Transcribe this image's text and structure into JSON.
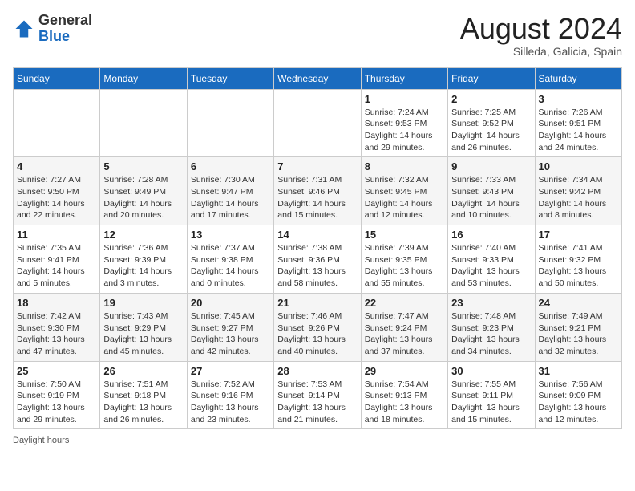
{
  "header": {
    "logo": {
      "general": "General",
      "blue": "Blue"
    },
    "title": "August 2024",
    "location": "Silleda, Galicia, Spain"
  },
  "calendar": {
    "weekdays": [
      "Sunday",
      "Monday",
      "Tuesday",
      "Wednesday",
      "Thursday",
      "Friday",
      "Saturday"
    ],
    "weeks": [
      [
        null,
        null,
        null,
        null,
        {
          "day": "1",
          "sunrise": "Sunrise: 7:24 AM",
          "sunset": "Sunset: 9:53 PM",
          "daylight": "Daylight: 14 hours and 29 minutes."
        },
        {
          "day": "2",
          "sunrise": "Sunrise: 7:25 AM",
          "sunset": "Sunset: 9:52 PM",
          "daylight": "Daylight: 14 hours and 26 minutes."
        },
        {
          "day": "3",
          "sunrise": "Sunrise: 7:26 AM",
          "sunset": "Sunset: 9:51 PM",
          "daylight": "Daylight: 14 hours and 24 minutes."
        }
      ],
      [
        {
          "day": "4",
          "sunrise": "Sunrise: 7:27 AM",
          "sunset": "Sunset: 9:50 PM",
          "daylight": "Daylight: 14 hours and 22 minutes."
        },
        {
          "day": "5",
          "sunrise": "Sunrise: 7:28 AM",
          "sunset": "Sunset: 9:49 PM",
          "daylight": "Daylight: 14 hours and 20 minutes."
        },
        {
          "day": "6",
          "sunrise": "Sunrise: 7:30 AM",
          "sunset": "Sunset: 9:47 PM",
          "daylight": "Daylight: 14 hours and 17 minutes."
        },
        {
          "day": "7",
          "sunrise": "Sunrise: 7:31 AM",
          "sunset": "Sunset: 9:46 PM",
          "daylight": "Daylight: 14 hours and 15 minutes."
        },
        {
          "day": "8",
          "sunrise": "Sunrise: 7:32 AM",
          "sunset": "Sunset: 9:45 PM",
          "daylight": "Daylight: 14 hours and 12 minutes."
        },
        {
          "day": "9",
          "sunrise": "Sunrise: 7:33 AM",
          "sunset": "Sunset: 9:43 PM",
          "daylight": "Daylight: 14 hours and 10 minutes."
        },
        {
          "day": "10",
          "sunrise": "Sunrise: 7:34 AM",
          "sunset": "Sunset: 9:42 PM",
          "daylight": "Daylight: 14 hours and 8 minutes."
        }
      ],
      [
        {
          "day": "11",
          "sunrise": "Sunrise: 7:35 AM",
          "sunset": "Sunset: 9:41 PM",
          "daylight": "Daylight: 14 hours and 5 minutes."
        },
        {
          "day": "12",
          "sunrise": "Sunrise: 7:36 AM",
          "sunset": "Sunset: 9:39 PM",
          "daylight": "Daylight: 14 hours and 3 minutes."
        },
        {
          "day": "13",
          "sunrise": "Sunrise: 7:37 AM",
          "sunset": "Sunset: 9:38 PM",
          "daylight": "Daylight: 14 hours and 0 minutes."
        },
        {
          "day": "14",
          "sunrise": "Sunrise: 7:38 AM",
          "sunset": "Sunset: 9:36 PM",
          "daylight": "Daylight: 13 hours and 58 minutes."
        },
        {
          "day": "15",
          "sunrise": "Sunrise: 7:39 AM",
          "sunset": "Sunset: 9:35 PM",
          "daylight": "Daylight: 13 hours and 55 minutes."
        },
        {
          "day": "16",
          "sunrise": "Sunrise: 7:40 AM",
          "sunset": "Sunset: 9:33 PM",
          "daylight": "Daylight: 13 hours and 53 minutes."
        },
        {
          "day": "17",
          "sunrise": "Sunrise: 7:41 AM",
          "sunset": "Sunset: 9:32 PM",
          "daylight": "Daylight: 13 hours and 50 minutes."
        }
      ],
      [
        {
          "day": "18",
          "sunrise": "Sunrise: 7:42 AM",
          "sunset": "Sunset: 9:30 PM",
          "daylight": "Daylight: 13 hours and 47 minutes."
        },
        {
          "day": "19",
          "sunrise": "Sunrise: 7:43 AM",
          "sunset": "Sunset: 9:29 PM",
          "daylight": "Daylight: 13 hours and 45 minutes."
        },
        {
          "day": "20",
          "sunrise": "Sunrise: 7:45 AM",
          "sunset": "Sunset: 9:27 PM",
          "daylight": "Daylight: 13 hours and 42 minutes."
        },
        {
          "day": "21",
          "sunrise": "Sunrise: 7:46 AM",
          "sunset": "Sunset: 9:26 PM",
          "daylight": "Daylight: 13 hours and 40 minutes."
        },
        {
          "day": "22",
          "sunrise": "Sunrise: 7:47 AM",
          "sunset": "Sunset: 9:24 PM",
          "daylight": "Daylight: 13 hours and 37 minutes."
        },
        {
          "day": "23",
          "sunrise": "Sunrise: 7:48 AM",
          "sunset": "Sunset: 9:23 PM",
          "daylight": "Daylight: 13 hours and 34 minutes."
        },
        {
          "day": "24",
          "sunrise": "Sunrise: 7:49 AM",
          "sunset": "Sunset: 9:21 PM",
          "daylight": "Daylight: 13 hours and 32 minutes."
        }
      ],
      [
        {
          "day": "25",
          "sunrise": "Sunrise: 7:50 AM",
          "sunset": "Sunset: 9:19 PM",
          "daylight": "Daylight: 13 hours and 29 minutes."
        },
        {
          "day": "26",
          "sunrise": "Sunrise: 7:51 AM",
          "sunset": "Sunset: 9:18 PM",
          "daylight": "Daylight: 13 hours and 26 minutes."
        },
        {
          "day": "27",
          "sunrise": "Sunrise: 7:52 AM",
          "sunset": "Sunset: 9:16 PM",
          "daylight": "Daylight: 13 hours and 23 minutes."
        },
        {
          "day": "28",
          "sunrise": "Sunrise: 7:53 AM",
          "sunset": "Sunset: 9:14 PM",
          "daylight": "Daylight: 13 hours and 21 minutes."
        },
        {
          "day": "29",
          "sunrise": "Sunrise: 7:54 AM",
          "sunset": "Sunset: 9:13 PM",
          "daylight": "Daylight: 13 hours and 18 minutes."
        },
        {
          "day": "30",
          "sunrise": "Sunrise: 7:55 AM",
          "sunset": "Sunset: 9:11 PM",
          "daylight": "Daylight: 13 hours and 15 minutes."
        },
        {
          "day": "31",
          "sunrise": "Sunrise: 7:56 AM",
          "sunset": "Sunset: 9:09 PM",
          "daylight": "Daylight: 13 hours and 12 minutes."
        }
      ]
    ]
  },
  "footer": {
    "label": "Daylight hours"
  },
  "colors": {
    "header_bg": "#1a6bbf",
    "accent": "#1a6bbf"
  }
}
